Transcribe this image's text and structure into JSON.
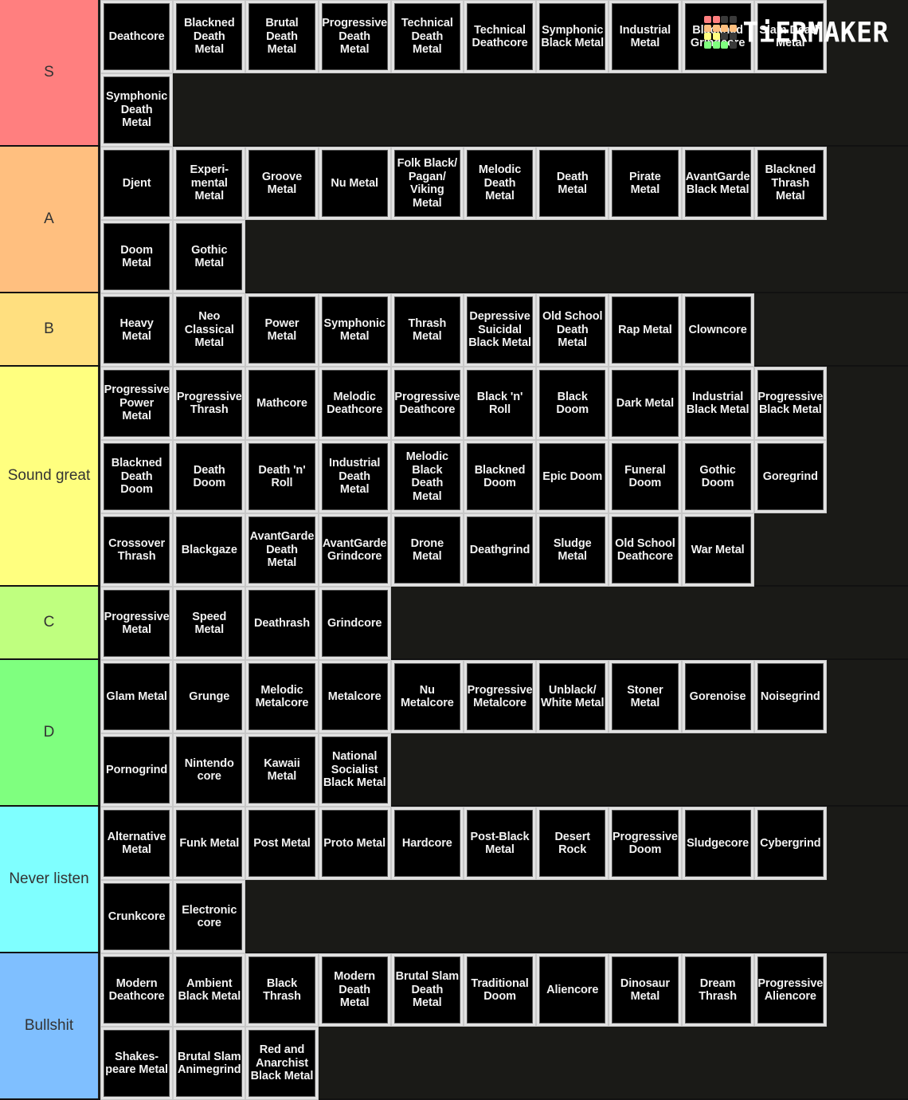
{
  "logo": {
    "text": "TiERMAKER",
    "grid_colors": [
      "#ff7f7f",
      "#ff7f7f",
      "#3a3a3a",
      "#3a3a3a",
      "#ffbf7f",
      "#ffbf7f",
      "#ffbf7f",
      "#ffbf7f",
      "#ffff7f",
      "#ffff7f",
      "#3a3a3a",
      "#3a3a3a",
      "#7fff7f",
      "#7fff7f",
      "#7fff7f",
      "#3a3a3a"
    ]
  },
  "tiers": [
    {
      "label": "S",
      "color": "#ff7f7f",
      "items": [
        "Deathcore",
        "Blackned\nDeath\nMetal",
        "Brutal\nDeath\nMetal",
        "Progressive\nDeath\nMetal",
        "Technical\nDeath\nMetal",
        "Technical\nDeathcore",
        "Symphonic\nBlack Metal",
        "Industrial\nMetal",
        "Blackned\nGrindcore",
        "Slam Death\nMetal",
        "Symphonic\nDeath\nMetal"
      ]
    },
    {
      "label": "A",
      "color": "#ffbf7f",
      "items": [
        "Djent",
        "Experi-\nmental\nMetal",
        "Groove\nMetal",
        "Nu Metal",
        "Folk Black/\nPagan/\nViking\nMetal",
        "Melodic\nDeath\nMetal",
        "Death\nMetal",
        "Pirate\nMetal",
        "AvantGarde\nBlack Metal",
        "Blackned\nThrash\nMetal",
        "Doom\nMetal",
        "Gothic\nMetal"
      ]
    },
    {
      "label": "B",
      "color": "#ffdf7f",
      "items": [
        "Heavy\nMetal",
        "Neo\nClassical\nMetal",
        "Power\nMetal",
        "Symphonic\nMetal",
        "Thrash\nMetal",
        "Depressive\nSuicidal\nBlack Metal",
        "Old School\nDeath\nMetal",
        "Rap Metal",
        "Clowncore"
      ]
    },
    {
      "label": "Sound great",
      "color": "#ffff7f",
      "items": [
        "Progressive\nPower\nMetal",
        "Progressive\nThrash",
        "Mathcore",
        "Melodic\nDeathcore",
        "Progressive\nDeathcore",
        "Black 'n'\nRoll",
        "Black\nDoom",
        "Dark Metal",
        "Industrial\nBlack Metal",
        "Progressive\nBlack Metal",
        "Blackned\nDeath\nDoom",
        "Death\nDoom",
        "Death 'n'\nRoll",
        "Industrial\nDeath\nMetal",
        "Melodic\nBlack\nDeath\nMetal",
        "Blackned\nDoom",
        "Epic Doom",
        "Funeral\nDoom",
        "Gothic\nDoom",
        "Goregrind",
        "Crossover\nThrash",
        "Blackgaze",
        "AvantGarde\nDeath\nMetal",
        "AvantGarde\nGrindcore",
        "Drone\nMetal",
        "Deathgrind",
        "Sludge\nMetal",
        "Old School\nDeathcore",
        "War Metal"
      ]
    },
    {
      "label": "C",
      "color": "#bfff7f",
      "items": [
        "Progressive\nMetal",
        "Speed\nMetal",
        "Deathrash",
        "Grindcore"
      ]
    },
    {
      "label": "D",
      "color": "#7fff7f",
      "items": [
        "Glam Metal",
        "Grunge",
        "Melodic\nMetalcore",
        "Metalcore",
        "Nu\nMetalcore",
        "Progressive\nMetalcore",
        "Unblack/\nWhite Metal",
        "Stoner\nMetal",
        "Gorenoise",
        "Noisegrind",
        "Pornogrind",
        "Nintendo\ncore",
        "Kawaii\nMetal",
        "National\nSocialist\nBlack Metal"
      ]
    },
    {
      "label": "Never listen",
      "color": "#7fffff",
      "items": [
        "Alternative\nMetal",
        "Funk Metal",
        "Post Metal",
        "Proto Metal",
        "Hardcore",
        "Post-Black\nMetal",
        "Desert\nRock",
        "Progressive\nDoom",
        "Sludgecore",
        "Cybergrind",
        "Crunkcore",
        "Electronic\ncore"
      ]
    },
    {
      "label": "Bullshit",
      "color": "#7fbfff",
      "items": [
        "Modern\nDeathcore",
        "Ambient\nBlack Metal",
        "Black\nThrash",
        "Modern\nDeath\nMetal",
        "Brutal Slam\nDeath\nMetal",
        "Traditional\nDoom",
        "Aliencore",
        "Dinosaur\nMetal",
        "Dream\nThrash",
        "Progressive\nAliencore",
        "Shakes-\npeare Metal",
        "Brutal Slam\nAnimegrind",
        "Red and\nAnarchist\nBlack Metal"
      ]
    }
  ]
}
